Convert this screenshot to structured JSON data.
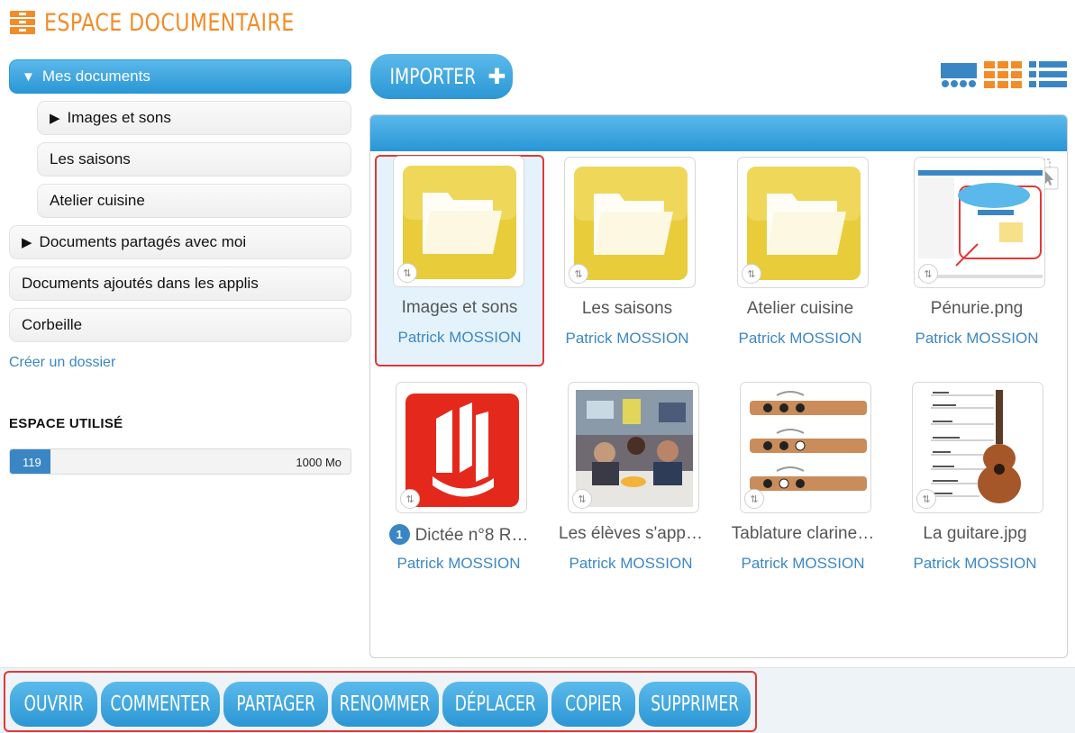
{
  "header": {
    "title": "ESPACE DOCUMENTAIRE",
    "icon": "documents-stack-icon",
    "accent": "#f28c28"
  },
  "sidebar": {
    "items": [
      {
        "label": "Mes documents",
        "caret": "▼",
        "active": true
      },
      {
        "label": "Images et sons",
        "caret": "▶",
        "child": true
      },
      {
        "label": "Les saisons",
        "child": true
      },
      {
        "label": "Atelier cuisine",
        "child": true
      },
      {
        "label": "Documents partagés avec moi",
        "caret": "▶"
      },
      {
        "label": "Documents ajoutés dans les applis"
      },
      {
        "label": "Corbeille"
      }
    ],
    "create_folder": "Créer un dossier"
  },
  "quota": {
    "title": "ESPACE UTILISÉ",
    "used": "119",
    "total": "1000 Mo",
    "fraction": 0.119
  },
  "toolbar": {
    "import_label": "IMPORTER",
    "import_plus": "✚",
    "view_modes": [
      "carousel-view-icon",
      "grid-view-icon",
      "list-view-icon"
    ]
  },
  "files": [
    {
      "name": "Images et sons",
      "owner": "Patrick MOSSION",
      "type": "folder",
      "selected": true
    },
    {
      "name": "Les saisons",
      "owner": "Patrick MOSSION",
      "type": "folder"
    },
    {
      "name": "Atelier cuisine",
      "owner": "Patrick MOSSION",
      "type": "folder"
    },
    {
      "name": "Pénurie.png",
      "owner": "Patrick MOSSION",
      "type": "screenshot"
    },
    {
      "name": "Dictée n°8 R…",
      "owner": "Patrick MOSSION",
      "type": "app-logo",
      "comments": "1"
    },
    {
      "name": "Les élèves s'app…",
      "owner": "Patrick MOSSION",
      "type": "photo"
    },
    {
      "name": "Tablature clarine…",
      "owner": "Patrick MOSSION",
      "type": "clarinet"
    },
    {
      "name": "La guitare.jpg",
      "owner": "Patrick MOSSION",
      "type": "guitar"
    }
  ],
  "actions": [
    "OUVRIR",
    "COMMENTER",
    "PARTAGER",
    "RENOMMER",
    "DÉPLACER",
    "COPIER",
    "SUPPRIMER"
  ],
  "colors": {
    "primary": "#2b96d4",
    "link": "#3d87c4",
    "highlight": "#e23838",
    "folder": "#e8cc3a"
  }
}
